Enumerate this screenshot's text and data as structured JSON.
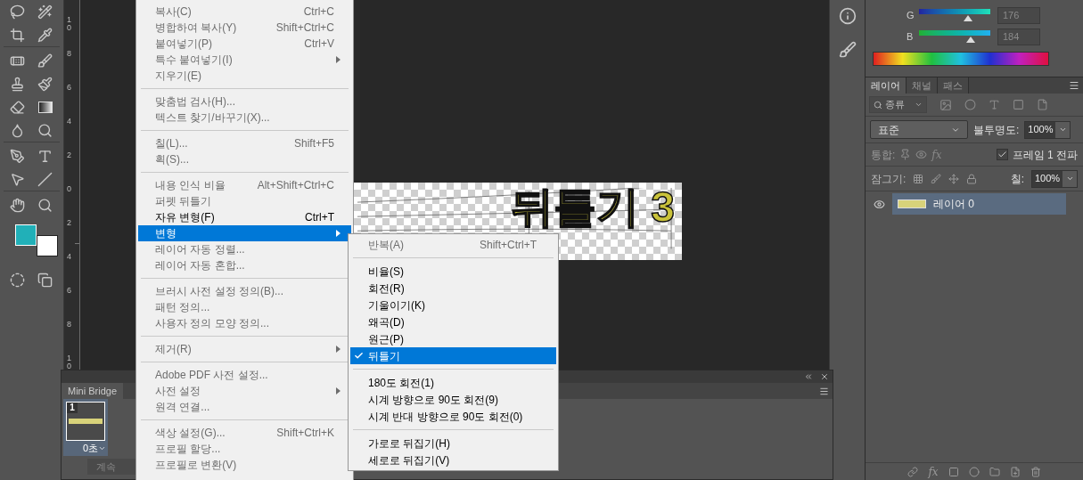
{
  "swatches": [
    {
      "kind": "foreground",
      "color": "#21b0b8"
    },
    {
      "kind": "background",
      "color": "#ffffff"
    }
  ],
  "ruler_labels": [
    "10",
    "8",
    "6",
    "4",
    "2",
    "0",
    "2",
    "4",
    "6",
    "8",
    "10"
  ],
  "canvas": {
    "text": "뒤틀기 3"
  },
  "edit_menu": {
    "items": [
      {
        "kind": "item",
        "label": "복사(C)",
        "shortcut": "Ctrl+C",
        "disabled": true,
        "selected": false,
        "submenu": false
      },
      {
        "kind": "item",
        "label": "병합하여 복사(Y)",
        "shortcut": "Shift+Ctrl+C",
        "disabled": true,
        "selected": false,
        "submenu": false
      },
      {
        "kind": "item",
        "label": "붙여넣기(P)",
        "shortcut": "Ctrl+V",
        "disabled": true,
        "selected": false,
        "submenu": false
      },
      {
        "kind": "item",
        "label": "특수 붙여넣기(I)",
        "disabled": true,
        "selected": false,
        "submenu": true
      },
      {
        "kind": "item",
        "label": "지우기(E)",
        "disabled": true,
        "selected": false,
        "submenu": false
      },
      {
        "kind": "separator"
      },
      {
        "kind": "item",
        "label": "맞춤법 검사(H)...",
        "disabled": true,
        "selected": false,
        "submenu": false
      },
      {
        "kind": "item",
        "label": "텍스트 찾기/바꾸기(X)...",
        "disabled": true,
        "selected": false,
        "submenu": false
      },
      {
        "kind": "separator"
      },
      {
        "kind": "item",
        "label": "칠(L)...",
        "shortcut": "Shift+F5",
        "disabled": true,
        "selected": false,
        "submenu": false
      },
      {
        "kind": "item",
        "label": "획(S)...",
        "disabled": true,
        "selected": false,
        "submenu": false
      },
      {
        "kind": "separator"
      },
      {
        "kind": "item",
        "label": "내용 인식 비율",
        "shortcut": "Alt+Shift+Ctrl+C",
        "disabled": true,
        "selected": false,
        "submenu": false
      },
      {
        "kind": "item",
        "label": "퍼펫 뒤틀기",
        "disabled": true,
        "selected": false,
        "submenu": false
      },
      {
        "kind": "item",
        "label": "자유 변형(F)",
        "shortcut": "Ctrl+T",
        "disabled": false,
        "selected": false,
        "submenu": false
      },
      {
        "kind": "item",
        "label": "변형",
        "disabled": false,
        "selected": true,
        "submenu": true
      },
      {
        "kind": "item",
        "label": "레이어 자동 정렬...",
        "disabled": true,
        "selected": false,
        "submenu": false
      },
      {
        "kind": "item",
        "label": "레이어 자동 혼합...",
        "disabled": true,
        "selected": false,
        "submenu": false
      },
      {
        "kind": "separator"
      },
      {
        "kind": "item",
        "label": "브러시 사전 설정 정의(B)...",
        "disabled": true,
        "selected": false,
        "submenu": false
      },
      {
        "kind": "item",
        "label": "패턴 정의...",
        "disabled": true,
        "selected": false,
        "submenu": false
      },
      {
        "kind": "item",
        "label": "사용자 정의 모양 정의...",
        "disabled": true,
        "selected": false,
        "submenu": false
      },
      {
        "kind": "separator"
      },
      {
        "kind": "item",
        "label": "제거(R)",
        "disabled": true,
        "selected": false,
        "submenu": true
      },
      {
        "kind": "separator"
      },
      {
        "kind": "item",
        "label": "Adobe PDF 사전 설정...",
        "disabled": true,
        "selected": false,
        "submenu": false
      },
      {
        "kind": "item",
        "label": "사전 설정",
        "disabled": true,
        "selected": false,
        "submenu": true
      },
      {
        "kind": "item",
        "label": "원격 연결...",
        "disabled": true,
        "selected": false,
        "submenu": false
      },
      {
        "kind": "separator"
      },
      {
        "kind": "item",
        "label": "색상 설정(G)...",
        "shortcut": "Shift+Ctrl+K",
        "disabled": true,
        "selected": false,
        "submenu": false
      },
      {
        "kind": "item",
        "label": "프로필 할당...",
        "disabled": true,
        "selected": false,
        "submenu": false
      },
      {
        "kind": "item",
        "label": "프로필로 변환(V)",
        "disabled": true,
        "selected": false,
        "submenu": false
      }
    ]
  },
  "transform_submenu": {
    "items": [
      {
        "kind": "item",
        "label": "반복(A)",
        "shortcut": "Shift+Ctrl+T",
        "disabled": true,
        "selected": false,
        "checked": false
      },
      {
        "kind": "separator"
      },
      {
        "kind": "item",
        "label": "비율(S)",
        "disabled": false,
        "selected": false,
        "checked": false
      },
      {
        "kind": "item",
        "label": "회전(R)",
        "disabled": false,
        "selected": false,
        "checked": false
      },
      {
        "kind": "item",
        "label": "기울이기(K)",
        "disabled": false,
        "selected": false,
        "checked": false
      },
      {
        "kind": "item",
        "label": "왜곡(D)",
        "disabled": false,
        "selected": false,
        "checked": false
      },
      {
        "kind": "item",
        "label": "원근(P)",
        "disabled": false,
        "selected": false,
        "checked": false
      },
      {
        "kind": "item",
        "label": "뒤틀기",
        "disabled": false,
        "selected": true,
        "checked": true
      },
      {
        "kind": "separator"
      },
      {
        "kind": "item",
        "label": "180도 회전(1)",
        "disabled": false,
        "selected": false,
        "checked": false
      },
      {
        "kind": "item",
        "label": "시계 방향으로 90도 회전(9)",
        "disabled": false,
        "selected": false,
        "checked": false
      },
      {
        "kind": "item",
        "label": "시계 반대 방향으로 90도 회전(0)",
        "disabled": false,
        "selected": false,
        "checked": false
      },
      {
        "kind": "separator"
      },
      {
        "kind": "item",
        "label": "가로로 뒤집기(H)",
        "disabled": false,
        "selected": false,
        "checked": false
      },
      {
        "kind": "item",
        "label": "세로로 뒤집기(V)",
        "disabled": false,
        "selected": false,
        "checked": false
      }
    ]
  },
  "color_panel": {
    "channels": [
      {
        "label": "G",
        "level": 0.69,
        "value": "176"
      },
      {
        "label": "B",
        "level": 0.72,
        "value": "184"
      }
    ]
  },
  "layers_panel": {
    "tabs": [
      {
        "label": "레이어",
        "selected": true
      },
      {
        "label": "채널",
        "selected": false
      },
      {
        "label": "패스",
        "selected": false
      }
    ],
    "filter": "종류",
    "blend_mode": "표준",
    "opacity_label": "불투명도:",
    "opacity": "100%",
    "unify_label": "통합:",
    "unify_style": "fx",
    "propagate": {
      "label": "프레임 1 전파",
      "checked": true
    },
    "lock_label": "잠그기:",
    "fill_label": "칠:",
    "fill": "100%",
    "layers": [
      {
        "name": "레이어 0",
        "visible": true,
        "selected": true
      }
    ],
    "style_button": "fx"
  },
  "mini_bridge": {
    "tab": "Mini Bridge",
    "frames": [
      {
        "number": "1",
        "delay": "0초",
        "selected": true
      }
    ],
    "loop": "계속"
  }
}
